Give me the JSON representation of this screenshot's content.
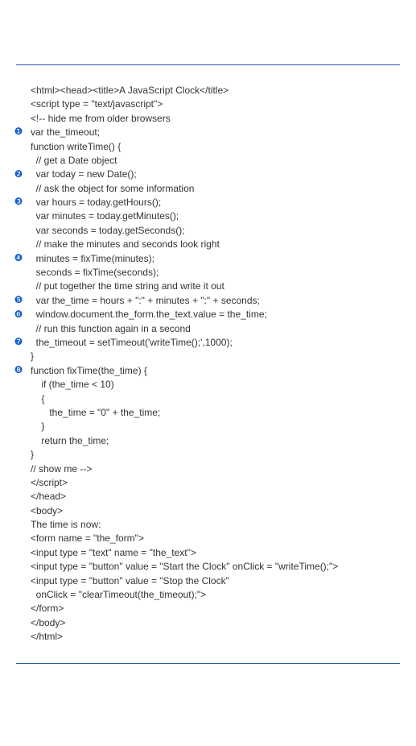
{
  "bullets": {
    "b1": "❶",
    "b2": "❷",
    "b3": "❸",
    "b4": "❹",
    "b5": "❺",
    "b6": "❻",
    "b7": "❼",
    "b8": "❽"
  },
  "code": {
    "l01": "<html><head><title>A JavaScript Clock</title>",
    "l02": "<script type = \"text/javascript\">",
    "l03": "<!-- hide me from older browsers",
    "l04": "var the_timeout;",
    "l05": "function writeTime() {",
    "l06": "  // get a Date object",
    "l07": "  var today = new Date();",
    "l08": "  // ask the object for some information",
    "l09": "  var hours = today.getHours();",
    "l10": "  var minutes = today.getMinutes();",
    "l11": "",
    "l12": "  var seconds = today.getSeconds();",
    "l13": "  // make the minutes and seconds look right",
    "l14": "  minutes = fixTime(minutes);",
    "l15": "  seconds = fixTime(seconds);",
    "l16": "  // put together the time string and write it out",
    "l17": "  var the_time = hours + \":\" + minutes + \":\" + seconds;",
    "l18": "  window.document.the_form.the_text.value = the_time;",
    "l19": "  // run this function again in a second",
    "l20": "  the_timeout = setTimeout('writeTime();',1000);",
    "l21": "}",
    "l22": "function fixTime(the_time) {",
    "l23": "    if (the_time < 10)",
    "l24": "    {",
    "l25": "       the_time = \"0\" + the_time;",
    "l26": "    }",
    "l27": "    return the_time;",
    "l28": "}",
    "l29": "// show me -->",
    "l30": "</script>",
    "l31": "</head>",
    "l32": "<body>",
    "l33": "The time is now:",
    "l34": "<form name = \"the_form\">",
    "l35": "<input type = \"text\" name = \"the_text\">",
    "l36": "<input type = \"button\" value = \"Start the Clock\" onClick = \"writeTime();\">",
    "l37": "<input type = \"button\" value = \"Stop the Clock\"",
    "l38": "  onClick = \"clearTimeout(the_timeout);\">",
    "l39": "</form>",
    "l40": "</body>",
    "l41": "</html>"
  }
}
